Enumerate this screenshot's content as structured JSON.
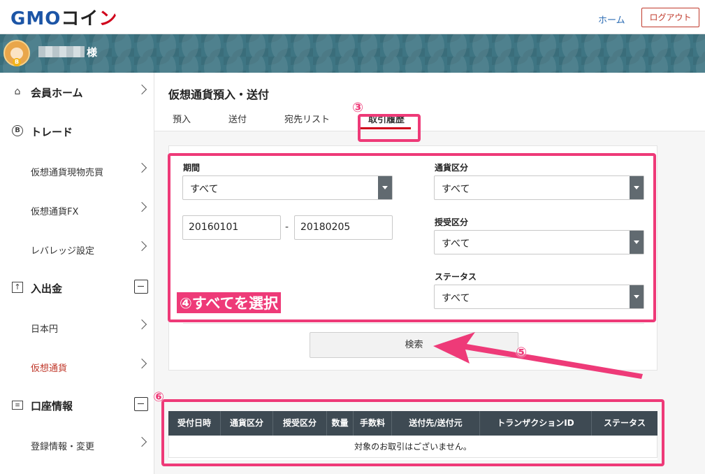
{
  "header": {
    "logo_main": "GMO",
    "logo_kana": "コイ",
    "logo_end": "ン",
    "home_link": "ホーム",
    "logout_button": "ログアウト"
  },
  "user": {
    "suffix": "様"
  },
  "sidebar": {
    "items": [
      {
        "label": "会員ホーム",
        "icon": "home-icon",
        "type": "main",
        "control": "chevron"
      },
      {
        "label": "トレード",
        "icon": "bitcoin-icon",
        "type": "main",
        "control": "none"
      },
      {
        "label": "仮想通貨現物売買",
        "type": "sub",
        "control": "chevron"
      },
      {
        "label": "仮想通貨FX",
        "type": "sub",
        "control": "chevron"
      },
      {
        "label": "レバレッジ設定",
        "type": "sub",
        "control": "chevron"
      },
      {
        "label": "入出金",
        "icon": "deposit-icon",
        "type": "main",
        "control": "collapse"
      },
      {
        "label": "日本円",
        "type": "sub",
        "control": "chevron"
      },
      {
        "label": "仮想通貨",
        "type": "sub",
        "control": "chevron",
        "active": true
      },
      {
        "label": "口座情報",
        "icon": "account-icon",
        "type": "main",
        "control": "collapse"
      },
      {
        "label": "登録情報・変更",
        "type": "sub",
        "control": "chevron"
      }
    ]
  },
  "main": {
    "title": "仮想通貨預入・送付",
    "tabs": [
      {
        "label": "預入",
        "active": false
      },
      {
        "label": "送付",
        "active": false
      },
      {
        "label": "宛先リスト",
        "active": false
      },
      {
        "label": "取引履歴",
        "active": true
      }
    ]
  },
  "filters": {
    "period_label": "期間",
    "period_value": "すべて",
    "date_from": "20160101",
    "date_separator": "-",
    "date_to": "20180205",
    "currency_type_label": "通貨区分",
    "currency_type_value": "すべて",
    "transfer_type_label": "授受区分",
    "transfer_type_value": "すべて",
    "status_label": "ステータス",
    "status_value": "すべて",
    "search_button": "検索"
  },
  "results_table": {
    "columns": [
      "受付日時",
      "通貨区分",
      "授受区分",
      "数量",
      "手数料",
      "送付先/送付元",
      "トランザクションID",
      "ステータス"
    ],
    "empty_message": "対象のお取引はございません。"
  },
  "annotations": {
    "step3": "③",
    "step4": "④すべてを選択",
    "step5": "⑤",
    "step6": "⑥",
    "accent_color": "#ee3a78"
  },
  "colors": {
    "brand_blue": "#1c55a6",
    "banner_teal": "#3e7583",
    "active_red": "#c0392b",
    "table_header": "#3e4a53"
  }
}
